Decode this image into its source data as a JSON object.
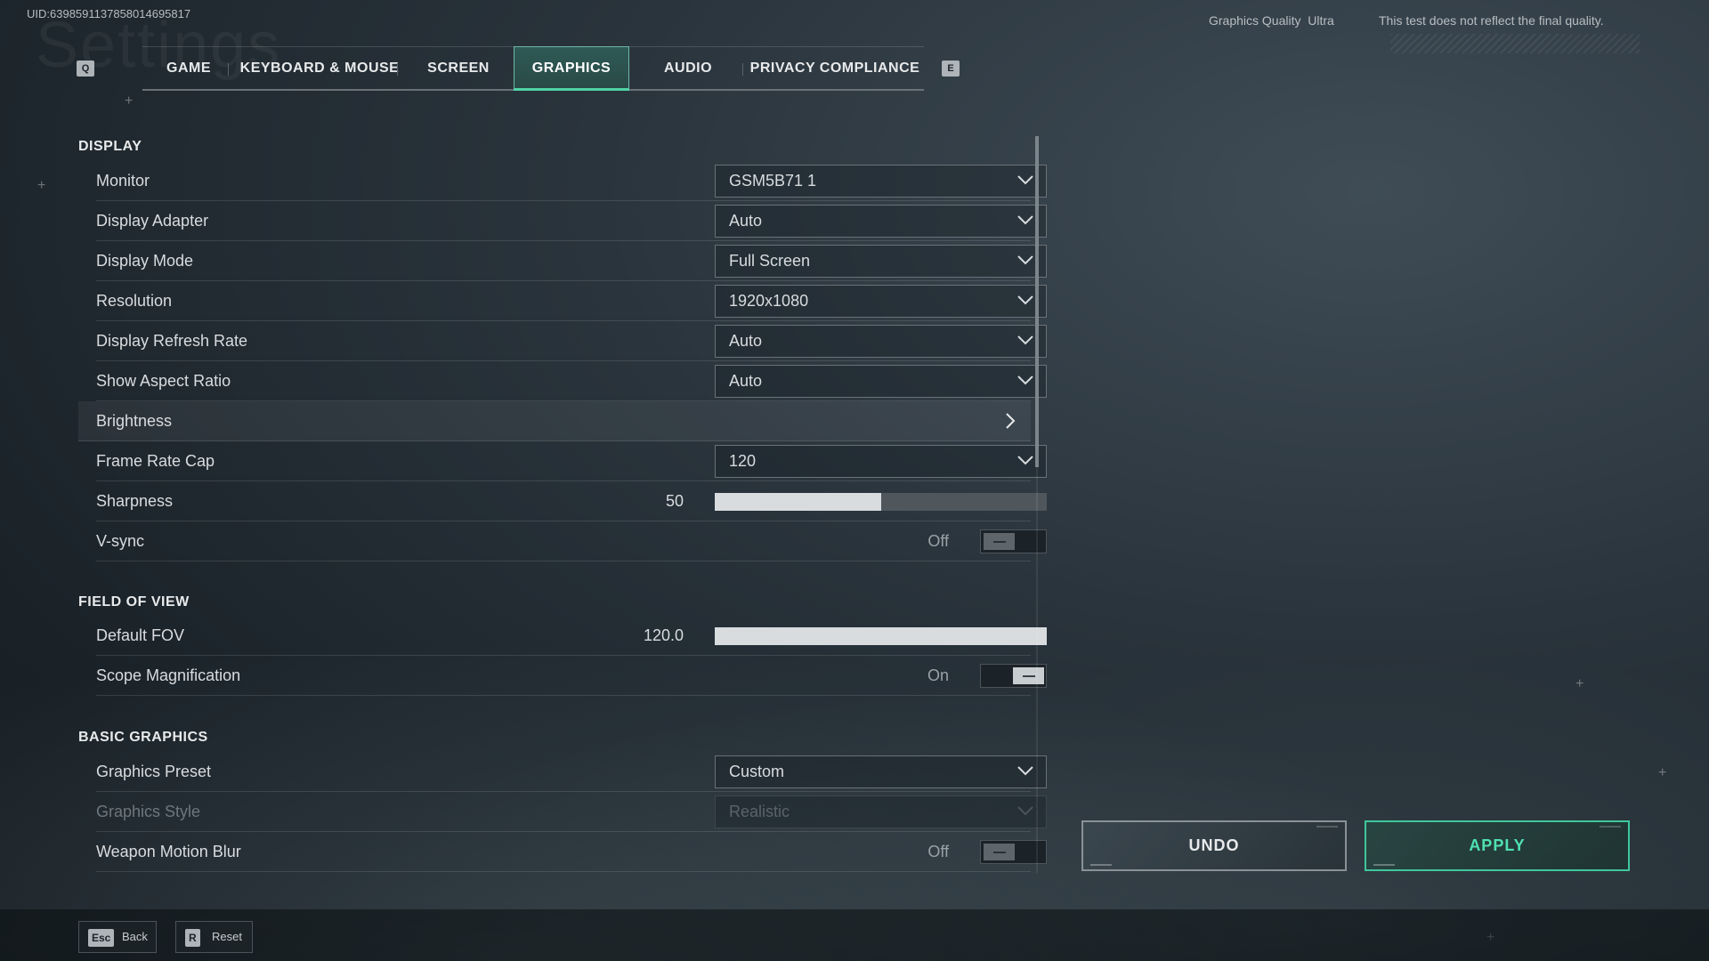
{
  "header": {
    "uid": "UID:6398591137858014695817",
    "ghost_title": "Settings",
    "graphics_quality_label": "Graphics Quality",
    "graphics_quality_value": "Ultra",
    "notice": "This test does not reflect the final quality."
  },
  "tabs": {
    "prev_key": "Q",
    "next_key": "E",
    "items": [
      {
        "label": "GAME"
      },
      {
        "label": "KEYBOARD & MOUSE"
      },
      {
        "label": "SCREEN"
      },
      {
        "label": "GRAPHICS"
      },
      {
        "label": "AUDIO"
      },
      {
        "label": "PRIVACY COMPLIANCE"
      }
    ],
    "active": "GRAPHICS"
  },
  "sections": {
    "display": "DISPLAY",
    "fov": "FIELD OF VIEW",
    "basic": "BASIC GRAPHICS"
  },
  "settings": {
    "monitor": {
      "label": "Monitor",
      "value": "GSM5B71 1"
    },
    "adapter": {
      "label": "Display Adapter",
      "value": "Auto"
    },
    "mode": {
      "label": "Display Mode",
      "value": "Full Screen"
    },
    "resolution": {
      "label": "Resolution",
      "value": "1920x1080"
    },
    "refresh": {
      "label": "Display Refresh Rate",
      "value": "Auto"
    },
    "aspect": {
      "label": "Show Aspect Ratio",
      "value": "Auto"
    },
    "brightness": {
      "label": "Brightness"
    },
    "framecap": {
      "label": "Frame Rate Cap",
      "value": "120"
    },
    "sharpness": {
      "label": "Sharpness",
      "value": "50",
      "fraction": 0.5
    },
    "vsync": {
      "label": "V-sync",
      "state": "Off"
    },
    "fov": {
      "label": "Default FOV",
      "value": "120.0",
      "fraction": 1.0
    },
    "scope": {
      "label": "Scope Magnification",
      "state": "On"
    },
    "preset": {
      "label": "Graphics Preset",
      "value": "Custom"
    },
    "style": {
      "label": "Graphics Style",
      "value": "Realistic"
    },
    "blur": {
      "label": "Weapon Motion Blur",
      "state": "Off"
    }
  },
  "actions": {
    "undo": "UNDO",
    "apply": "APPLY"
  },
  "footer": {
    "back_key": "Esc",
    "back_label": "Back",
    "reset_key": "R",
    "reset_label": "Reset"
  },
  "colors": {
    "accent": "#4fd3a6",
    "background": "#2a343c"
  }
}
